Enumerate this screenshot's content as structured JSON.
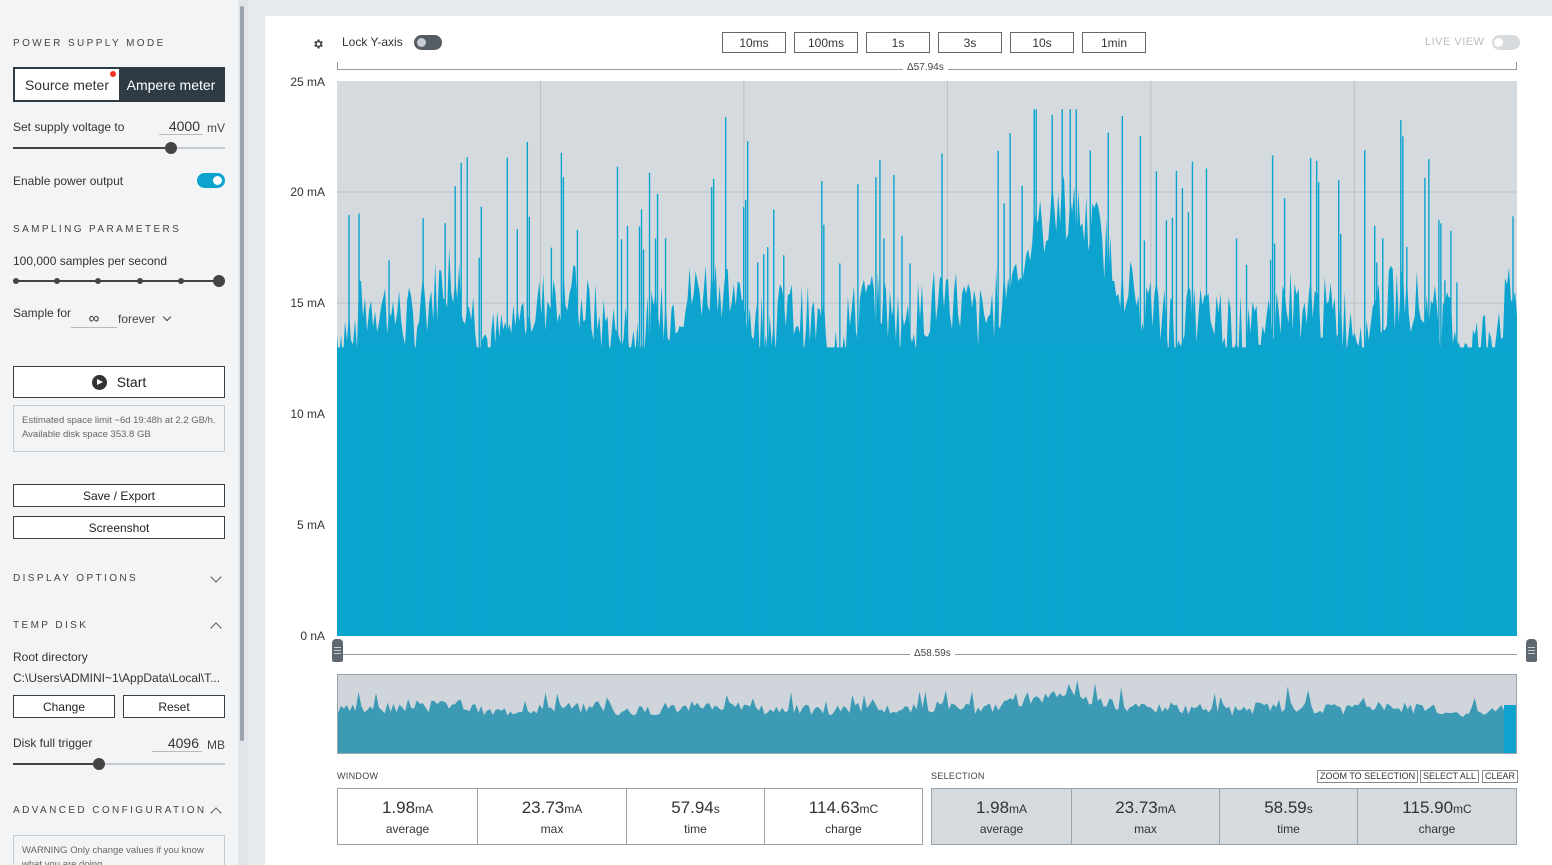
{
  "sidebar": {
    "power_supply_heading": "POWER SUPPLY MODE",
    "mode_source": "Source meter",
    "mode_ampere": "Ampere meter",
    "supply_voltage_label": "Set supply voltage to",
    "supply_voltage_value": "4000",
    "supply_voltage_unit": "mV",
    "enable_output_label": "Enable power output",
    "sampling_heading": "SAMPLING PARAMETERS",
    "samples_label": "100,000 samples per second",
    "sample_for_label": "Sample for",
    "sample_for_value": "∞",
    "sample_for_unit": "forever",
    "start_label": "Start",
    "space_info": "Estimated space limit ~6d 19:48h at 2.2 GB/h. Available disk space 353.8 GB",
    "save_export_label": "Save / Export",
    "screenshot_label": "Screenshot",
    "display_options_heading": "DISPLAY OPTIONS",
    "temp_disk_heading": "TEMP DISK",
    "root_dir_label": "Root directory",
    "root_dir_value": "C:\\Users\\ADMINI~1\\AppData\\Local\\T...",
    "change_label": "Change",
    "reset_label": "Reset",
    "disk_trigger_label": "Disk full trigger",
    "disk_trigger_value": "4096",
    "disk_trigger_unit": "MB",
    "advanced_heading": "ADVANCED CONFIGURATION",
    "warning_text": "WARNING Only change values if you know what you are doing"
  },
  "toolbar": {
    "lock_y_label": "Lock Y-axis",
    "window_buttons": [
      "10ms",
      "100ms",
      "1s",
      "3s",
      "10s",
      "1min"
    ],
    "live_view_label": "LIVE VIEW"
  },
  "chart": {
    "top_delta": "Δ57.94s",
    "bottom_delta": "Δ58.59s",
    "y_ticks": [
      "25 mA",
      "20 mA",
      "15 mA",
      "10 mA",
      "5 mA",
      "0 nA"
    ]
  },
  "chart_data": {
    "type": "area",
    "ylim": [
      0,
      25
    ],
    "ylabel": "",
    "y_ticks": [
      "25 mA",
      "20 mA",
      "15 mA",
      "10 mA",
      "5 mA",
      "0 nA"
    ],
    "series": [
      {
        "values": [
          14.5,
          16,
          15,
          17.5,
          14,
          15.5,
          16.5,
          15,
          14.5,
          16,
          17,
          15,
          15.5,
          14.5,
          16,
          15,
          16.5,
          15,
          18,
          20.5,
          19,
          16,
          15,
          15.5,
          14.5,
          16,
          15.5,
          15,
          16.5,
          15,
          14,
          16.5
        ]
      }
    ],
    "grid": true,
    "color": "#0ca4cf"
  },
  "stats": {
    "window_heading": "WINDOW",
    "selection_heading": "SELECTION",
    "zoom_to_selection": "ZOOM TO SELECTION",
    "select_all": "SELECT ALL",
    "clear": "CLEAR",
    "window": [
      {
        "value": "1.98",
        "unit": "mA",
        "label": "average"
      },
      {
        "value": "23.73",
        "unit": "mA",
        "label": "max"
      },
      {
        "value": "57.94",
        "unit": "s",
        "label": "time"
      },
      {
        "value": "114.63",
        "unit": "mC",
        "label": "charge"
      }
    ],
    "selection": [
      {
        "value": "1.98",
        "unit": "mA",
        "label": "average"
      },
      {
        "value": "23.73",
        "unit": "mA",
        "label": "max"
      },
      {
        "value": "58.59",
        "unit": "s",
        "label": "time"
      },
      {
        "value": "115.90",
        "unit": "mC",
        "label": "charge"
      }
    ]
  },
  "colors": {
    "accent": "#0ca4cf",
    "dark": "#2e3a44",
    "minimap": "#3c9ab5"
  }
}
